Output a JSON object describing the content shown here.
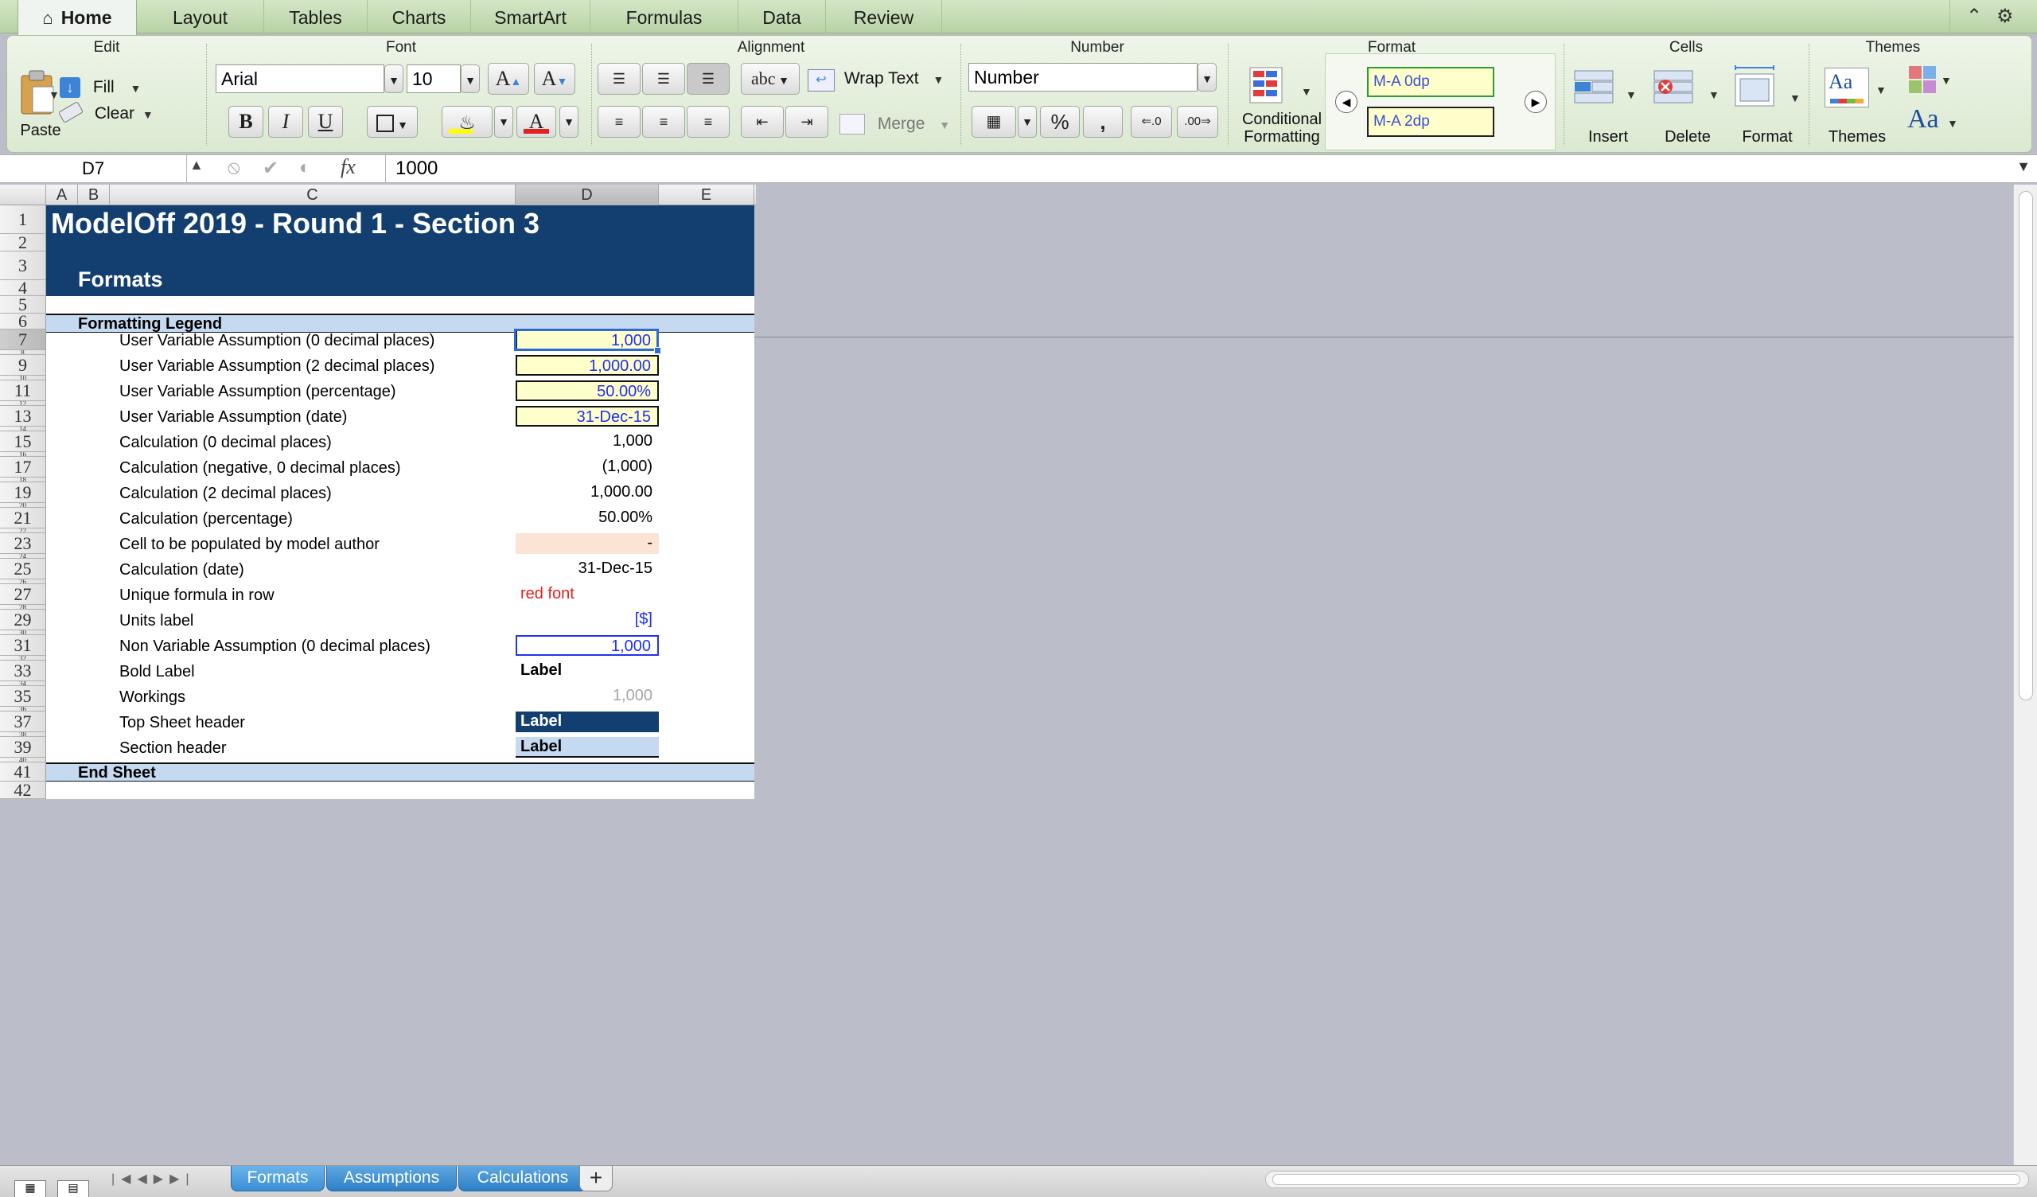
{
  "ribbon_tabs": [
    "Home",
    "Layout",
    "Tables",
    "Charts",
    "SmartArt",
    "Formulas",
    "Data",
    "Review"
  ],
  "groups": {
    "edit": {
      "title": "Edit",
      "paste": "Paste",
      "fill": "Fill",
      "clear": "Clear"
    },
    "font": {
      "title": "Font",
      "font_name": "Arial",
      "font_size": "10",
      "bold": "B",
      "italic": "I",
      "underline": "U",
      "grow": "A",
      "shrink": "A",
      "font_color": "A"
    },
    "alignment": {
      "title": "Alignment",
      "wrap_text": "Wrap Text",
      "merge": "Merge",
      "abc": "abc"
    },
    "number": {
      "title": "Number",
      "format": "Number",
      "percent": "%",
      "comma": ","
    },
    "format": {
      "title": "Format",
      "conditional_line1": "Conditional",
      "conditional_line2": "Formatting",
      "style1": "M-A 0dp",
      "style2": "M-A 2dp"
    },
    "cells": {
      "title": "Cells",
      "insert": "Insert",
      "delete": "Delete",
      "format": "Format"
    },
    "themes": {
      "title": "Themes",
      "themes": "Themes",
      "aa_small": "Aa",
      "aa_big": "Aa"
    }
  },
  "formula_bar": {
    "cell_ref": "D7",
    "fx": "fx",
    "value": "1000"
  },
  "columns": [
    "A",
    "B",
    "C",
    "D",
    "E"
  ],
  "rows": [
    "1",
    "2",
    "3",
    "4",
    "5",
    "6",
    "7",
    "8",
    "9",
    "10",
    "11",
    "12",
    "13",
    "14",
    "15",
    "16",
    "17",
    "18",
    "19",
    "20",
    "21",
    "22",
    "23",
    "24",
    "25",
    "26",
    "27",
    "28",
    "29",
    "30",
    "31",
    "32",
    "33",
    "34",
    "35",
    "36",
    "37",
    "38",
    "39",
    "40",
    "41",
    "42"
  ],
  "sheet": {
    "title": "ModelOff 2019 - Round 1 - Section 3",
    "subtitle": "Formats",
    "legend_header": "Formatting Legend",
    "end_sheet": "End Sheet",
    "items": [
      {
        "label": "User Variable Assumption (0 decimal places)",
        "value": "1,000",
        "style": "input",
        "row": 7
      },
      {
        "label": "User Variable Assumption (2 decimal places)",
        "value": "1,000.00",
        "style": "input",
        "row": 9
      },
      {
        "label": "User Variable Assumption (percentage)",
        "value": "50.00%",
        "style": "input",
        "row": 11
      },
      {
        "label": "User Variable Assumption (date)",
        "value": "31-Dec-15",
        "style": "input",
        "row": 13
      },
      {
        "label": "Calculation (0 decimal places)",
        "value": "1,000",
        "style": "calc",
        "row": 15
      },
      {
        "label": "Calculation (negative, 0 decimal places)",
        "value": "(1,000)",
        "style": "calc",
        "row": 17
      },
      {
        "label": "Calculation (2 decimal places)",
        "value": "1,000.00",
        "style": "calc",
        "row": 19
      },
      {
        "label": "Calculation (percentage)",
        "value": "50.00%",
        "style": "calc",
        "row": 21
      },
      {
        "label": "Cell to be populated by model author",
        "value": "-",
        "style": "author",
        "row": 23
      },
      {
        "label": "Calculation (date)",
        "value": "31-Dec-15",
        "style": "calc",
        "row": 25
      },
      {
        "label": "Unique formula in row",
        "value": "red font",
        "style": "red",
        "row": 27
      },
      {
        "label": "Units label",
        "value": "[$]",
        "style": "units",
        "row": 29
      },
      {
        "label": "Non Variable Assumption (0 decimal places)",
        "value": "1,000",
        "style": "blueb",
        "row": 31
      },
      {
        "label": "Bold Label",
        "value": "Label",
        "style": "bold",
        "row": 33
      },
      {
        "label": "Workings",
        "value": "1,000",
        "style": "grey",
        "row": 35
      },
      {
        "label": "Top Sheet header",
        "value": "Label",
        "style": "top",
        "row": 37
      },
      {
        "label": "Section header",
        "value": "Label",
        "style": "section",
        "row": 39
      }
    ]
  },
  "sheet_tabs": [
    {
      "name": "Formats",
      "active": true
    },
    {
      "name": "Assumptions",
      "active": false
    },
    {
      "name": "Calculations",
      "active": false
    }
  ],
  "add_sheet": "+",
  "colors": {
    "header_navy": "#123e70",
    "input_fill": "#ffffcc",
    "section_fill": "#c5d9f1",
    "input_font": "#1f2ff0",
    "unique_red": "#e0221f"
  }
}
